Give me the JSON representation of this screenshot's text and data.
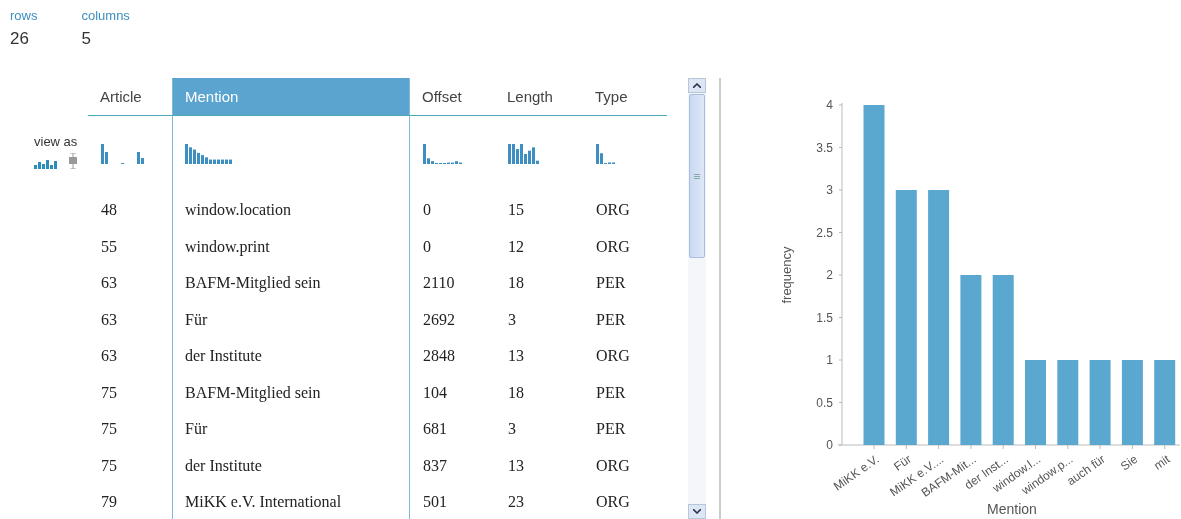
{
  "stats": [
    {
      "label": "rows",
      "value": "26"
    },
    {
      "label": "columns",
      "value": "5"
    }
  ],
  "view_as": {
    "label": "view as",
    "options": [
      {
        "kind": "histogram",
        "selected": true
      },
      {
        "kind": "boxplot",
        "selected": false
      }
    ]
  },
  "table": {
    "columns": [
      {
        "name": "Article",
        "selected": false
      },
      {
        "name": "Mention",
        "selected": true
      },
      {
        "name": "Offset",
        "selected": false
      },
      {
        "name": "Length",
        "selected": false
      },
      {
        "name": "Type",
        "selected": false
      }
    ],
    "rows": [
      [
        "48",
        "window.location",
        "0",
        "15",
        "ORG"
      ],
      [
        "55",
        "window.print",
        "0",
        "12",
        "ORG"
      ],
      [
        "63",
        "BAFM-Mitglied sein",
        "2110",
        "18",
        "PER"
      ],
      [
        "63",
        "Für",
        "2692",
        "3",
        "PER"
      ],
      [
        "63",
        "der Institute",
        "2848",
        "13",
        "ORG"
      ],
      [
        "75",
        "BAFM-Mitglied sein",
        "104",
        "18",
        "PER"
      ],
      [
        "75",
        "Für",
        "681",
        "3",
        "PER"
      ],
      [
        "75",
        "der Institute",
        "837",
        "13",
        "ORG"
      ],
      [
        "79",
        "MiKK e.V. International",
        "501",
        "23",
        "ORG"
      ]
    ]
  },
  "chart": {
    "chart_data": {
      "type": "bar",
      "xlabel": "Mention",
      "ylabel": "frequency",
      "categories": [
        "MiKK e.V.",
        "Für",
        "MiKK e.V....",
        "BAFM-Mit...",
        "der Inst...",
        "window.l...",
        "window.p...",
        "auch für",
        "Sie",
        "mit"
      ],
      "series": [
        {
          "color": "#5aa7d0",
          "values": [
            4,
            3,
            3,
            2,
            2,
            1,
            1,
            1,
            1,
            1
          ]
        }
      ],
      "ylim": [
        0,
        4
      ],
      "yticks": [
        0,
        0.5,
        1,
        1.5,
        2,
        2.5,
        3,
        3.5,
        4
      ]
    }
  }
}
